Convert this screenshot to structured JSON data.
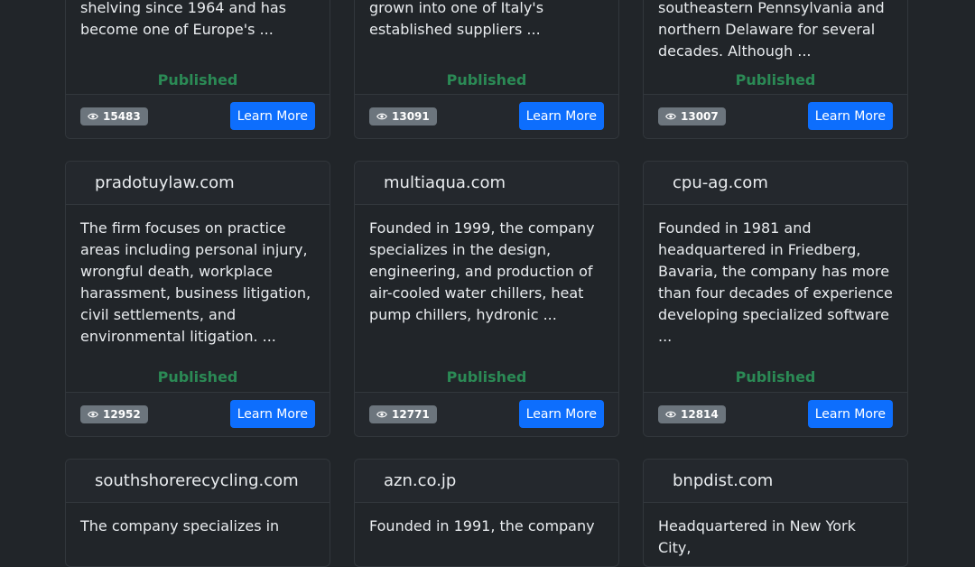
{
  "cards": [
    {
      "domain": "",
      "description": "shelving since 1964 and has become one of Europe's ...",
      "status": "Published",
      "views": "15483",
      "button": "Learn More"
    },
    {
      "domain": "",
      "description": "grown into one of Italy's established suppliers ...",
      "status": "Published",
      "views": "13091",
      "button": "Learn More"
    },
    {
      "domain": "",
      "description": "southeastern Pennsylvania and northern Delaware for several decades. Although ...",
      "status": "Published",
      "views": "13007",
      "button": "Learn More"
    },
    {
      "domain": "pradotuylaw.com",
      "description": "The firm focuses on practice areas including personal injury, wrongful death, workplace harassment, business litigation, civil settlements, and environmental litigation. ...",
      "status": "Published",
      "views": "12952",
      "button": "Learn More"
    },
    {
      "domain": "multiaqua.com",
      "description": "Founded in 1999, the company specializes in the design, engineering, and production of air-cooled water chillers, heat pump chillers, hydronic ...",
      "status": "Published",
      "views": "12771",
      "button": "Learn More"
    },
    {
      "domain": "cpu-ag.com",
      "description": "Founded in 1981 and headquartered in Friedberg, Bavaria, the company has more than four decades of experience developing specialized software ...",
      "status": "Published",
      "views": "12814",
      "button": "Learn More"
    },
    {
      "domain": "southshorerecycling.com",
      "description": "The company specializes in",
      "status": "",
      "views": "",
      "button": ""
    },
    {
      "domain": "azn.co.jp",
      "description": "Founded in 1991, the company",
      "status": "",
      "views": "",
      "button": ""
    },
    {
      "domain": "bnpdist.com",
      "description": "Headquartered in New York City,",
      "status": "",
      "views": "",
      "button": ""
    }
  ]
}
